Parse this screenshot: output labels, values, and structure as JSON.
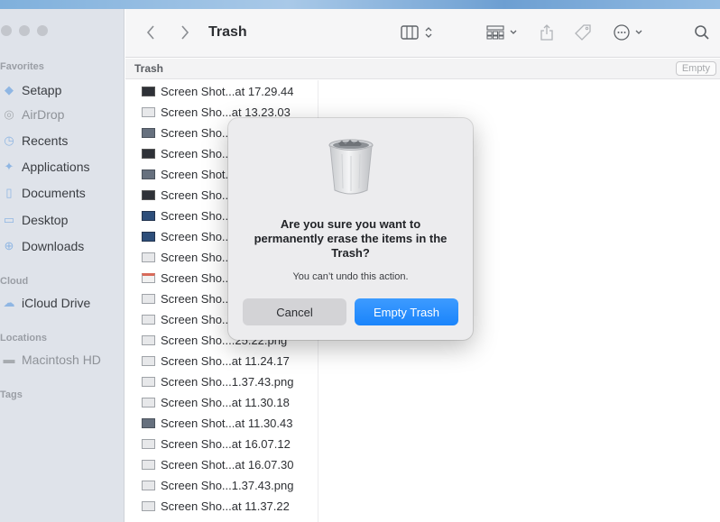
{
  "toolbar": {
    "title": "Trash"
  },
  "pathbar": {
    "label": "Trash",
    "empty_button": "Empty"
  },
  "sidebar": {
    "sections": {
      "favorites": "Favorites",
      "cloud": "Cloud",
      "locations": "Locations",
      "tags": "Tags"
    },
    "favorites": [
      {
        "label": "Setapp",
        "icon": "setapp-icon"
      },
      {
        "label": "AirDrop",
        "icon": "airdrop-icon"
      },
      {
        "label": "Recents",
        "icon": "clock-icon"
      },
      {
        "label": "Applications",
        "icon": "applications-icon"
      },
      {
        "label": "Documents",
        "icon": "document-icon"
      },
      {
        "label": "Desktop",
        "icon": "desktop-icon"
      },
      {
        "label": "Downloads",
        "icon": "download-icon"
      }
    ],
    "cloud": [
      {
        "label": "iCloud Drive",
        "icon": "cloud-icon"
      }
    ],
    "locations": [
      {
        "label": "Macintosh HD",
        "icon": "disk-icon"
      }
    ]
  },
  "files": [
    {
      "name": "Screen Shot...at 17.29.44"
    },
    {
      "name": "Screen Sho...at 13.23.03"
    },
    {
      "name": "Screen Sho..."
    },
    {
      "name": "Screen Sho..."
    },
    {
      "name": "Screen Shot..."
    },
    {
      "name": "Screen Sho..."
    },
    {
      "name": "Screen Sho..."
    },
    {
      "name": "Screen Sho..."
    },
    {
      "name": "Screen Sho..."
    },
    {
      "name": "Screen Sho..."
    },
    {
      "name": "Screen Sho..."
    },
    {
      "name": "Screen Sho..."
    },
    {
      "name": "Screen Sho....25.22.png"
    },
    {
      "name": "Screen Sho...at 11.24.17"
    },
    {
      "name": "Screen Sho...1.37.43.png"
    },
    {
      "name": "Screen Sho...at 11.30.18"
    },
    {
      "name": "Screen Shot...at 11.30.43"
    },
    {
      "name": "Screen Sho...at 16.07.12"
    },
    {
      "name": "Screen Shot...at 16.07.30"
    },
    {
      "name": "Screen Sho...1.37.43.png"
    },
    {
      "name": "Screen Sho...at 11.37.22"
    }
  ],
  "dialog": {
    "title": "Are you sure you want to permanently erase the items in the Trash?",
    "message": "You can’t undo this action.",
    "cancel_label": "Cancel",
    "confirm_label": "Empty Trash"
  },
  "colors": {
    "accent": "#1a84fb",
    "sidebar_bg": "#dfe3ea",
    "dialog_bg": "#ececee"
  }
}
